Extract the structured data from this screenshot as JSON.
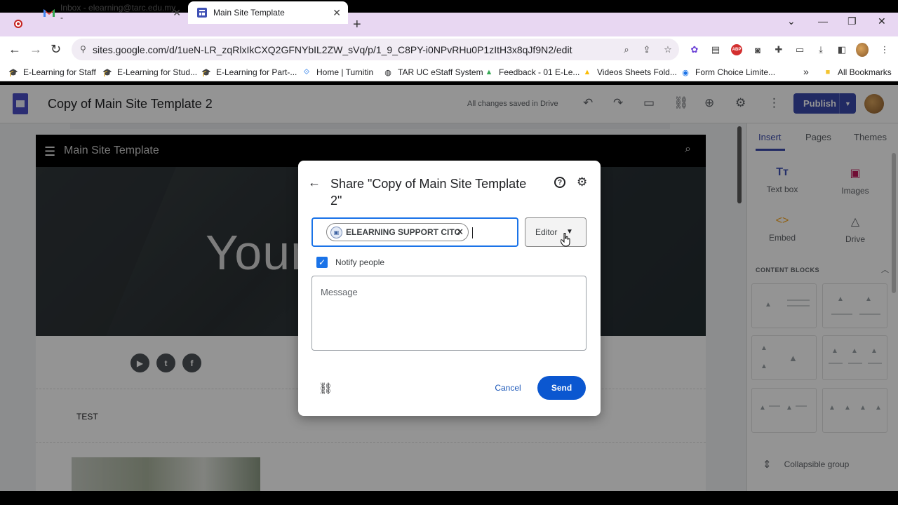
{
  "browser": {
    "tabs": [
      {
        "label": "Inbox - elearning@tarc.edu.my -",
        "icon": "gmail-icon"
      },
      {
        "label": "Main Site Template",
        "icon": "sites-icon",
        "active": true
      }
    ],
    "url": "sites.google.com/d/1ueN-LR_zqRlxIkCXQ2GFNYbIL2ZW_sVq/p/1_9_C8PY-i0NPvRHu0P1zItH3x8qJf9N2/edit",
    "bookmarks": [
      "E-Learning for Staff",
      "E-Learning for Stud...",
      "E-Learning for Part-...",
      "Home | Turnitin",
      "TAR UC eStaff System",
      "Feedback - 01 E-Le...",
      "Videos Sheets Fold...",
      "Form Choice Limite..."
    ],
    "all_bookmarks": "All Bookmarks",
    "bookmarks_overflow": "»"
  },
  "editor": {
    "doc_title": "Copy of Main Site Template 2",
    "save_status": "All changes saved in Drive",
    "publish_label": "Publish"
  },
  "site": {
    "nav_title": "Main Site Template",
    "hero_text": "Your",
    "section_text": "TEST",
    "social": [
      "youtube",
      "twitter",
      "facebook"
    ]
  },
  "panel": {
    "tabs": [
      "Insert",
      "Pages",
      "Themes"
    ],
    "items": [
      {
        "label": "Text box",
        "icon": "Tт"
      },
      {
        "label": "Images",
        "icon": "▣"
      },
      {
        "label": "Embed",
        "icon": "<>"
      },
      {
        "label": "Drive",
        "icon": "△"
      }
    ],
    "content_blocks_label": "CONTENT BLOCKS",
    "collapsible_label": "Collapsible group"
  },
  "dialog": {
    "title": "Share \"Copy of Main Site Template 2\"",
    "chip_label": "ELEARNING SUPPORT CITC",
    "role": "Editor",
    "notify_label": "Notify people",
    "notify_checked": true,
    "message_placeholder": "Message",
    "cancel_label": "Cancel",
    "send_label": "Send"
  },
  "colors": {
    "accent": "#1a73e8",
    "send": "#0b57d0",
    "publish": "#3949ab",
    "tabstrip": "#e8d7f2"
  }
}
